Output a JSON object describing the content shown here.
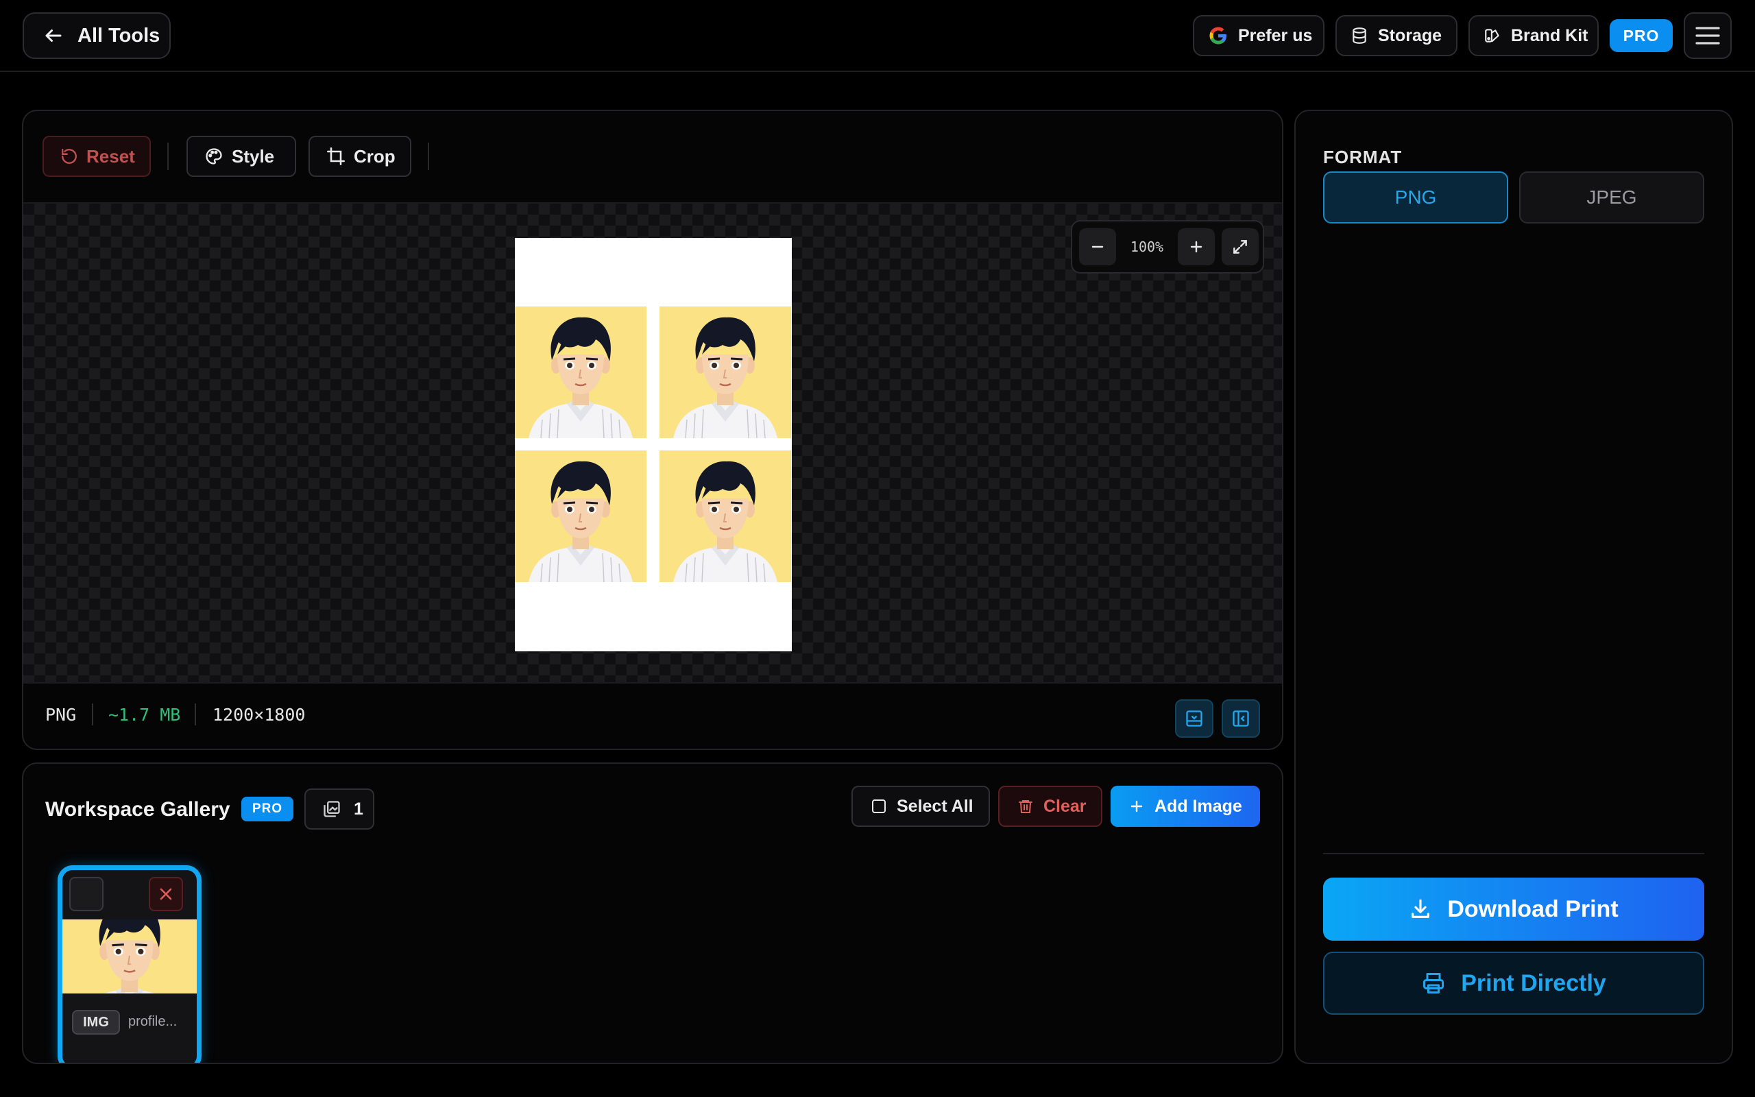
{
  "topbar": {
    "all_tools_label": "All Tools",
    "prefer_us_label": "Prefer us",
    "storage_label": "Storage",
    "brand_kit_label": "Brand Kit",
    "pro_label": "PRO"
  },
  "toolbar": {
    "reset_label": "Reset",
    "style_label": "Style",
    "crop_label": "Crop"
  },
  "zoom": {
    "level": "100%"
  },
  "status": {
    "format": "PNG",
    "size": "~1.7 MB",
    "dimensions": "1200×1800"
  },
  "gallery": {
    "title": "Workspace Gallery",
    "pro_label": "PRO",
    "count": "1",
    "select_all_label": "Select All",
    "clear_label": "Clear",
    "add_image_label": "Add Image",
    "items": [
      {
        "type_tag": "IMG",
        "name": "profile..."
      }
    ]
  },
  "format_panel": {
    "label": "FORMAT",
    "options": [
      "PNG",
      "JPEG"
    ],
    "selected": "PNG"
  },
  "actions": {
    "download_label": "Download Print",
    "print_label": "Print Directly"
  },
  "colors": {
    "accent": "#0a8ff0",
    "danger": "#c0514f",
    "size_text": "#2fbf7a",
    "photo_bg": "#fbe285"
  }
}
